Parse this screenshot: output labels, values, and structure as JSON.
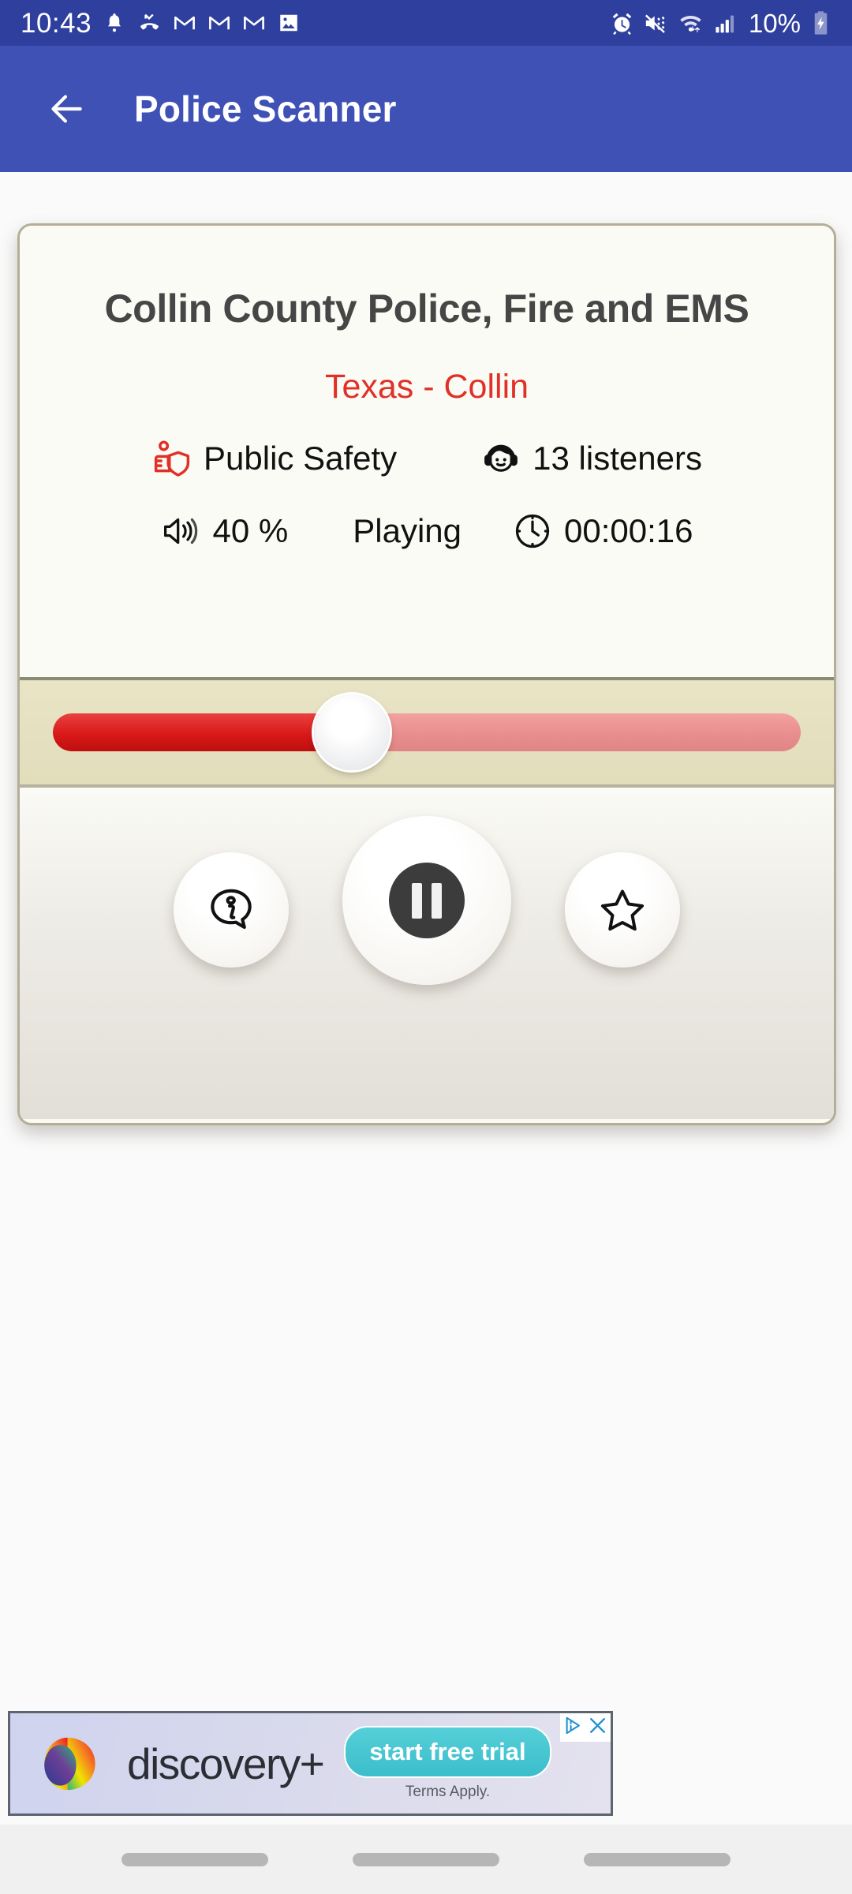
{
  "status_bar": {
    "time": "10:43",
    "battery_text": "10%",
    "left_icons": [
      "notification-bell-icon",
      "missed-call-icon",
      "gmail-icon",
      "gmail-icon",
      "gmail-icon",
      "photos-icon"
    ],
    "right_icons": [
      "alarm-icon",
      "vibrate-mute-icon",
      "wifi-icon",
      "signal-bars-icon",
      "battery-charging-icon"
    ],
    "background_color": "#2f3f9e"
  },
  "app_bar": {
    "title": "Police Scanner",
    "back_icon": "arrow-left-icon",
    "background_color": "#3f51b5"
  },
  "card": {
    "station_name": "Collin County Police, Fire and EMS",
    "location": "Texas - Collin",
    "location_color": "#e03027",
    "genre": {
      "icon": "police-badge-icon",
      "label": "Public Safety",
      "icon_color": "#e03027"
    },
    "listeners": {
      "icon": "headphones-person-icon",
      "label": "13 listeners"
    },
    "volume": {
      "icon": "volume-icon",
      "label": "40 %",
      "percent": 40
    },
    "state": {
      "label": "Playing"
    },
    "elapsed": {
      "icon": "clock-icon",
      "label": "00:00:16"
    },
    "slider": {
      "value_percent": 40,
      "fill_color": "#d81818",
      "track_color": "#e98e8e"
    },
    "controls": {
      "info_icon": "info-bubble-icon",
      "pause_icon": "pause-icon",
      "favorite_icon": "star-outline-icon"
    }
  },
  "ad": {
    "brand": "discovery+",
    "cta": "start free trial",
    "terms": "Terms Apply.",
    "adchoices_icon": "adchoices-icon",
    "close_icon": "close-icon",
    "cta_color": "#3bbecb"
  },
  "nav_bar": {
    "items": [
      "recents-pill",
      "home-pill",
      "back-pill"
    ]
  }
}
